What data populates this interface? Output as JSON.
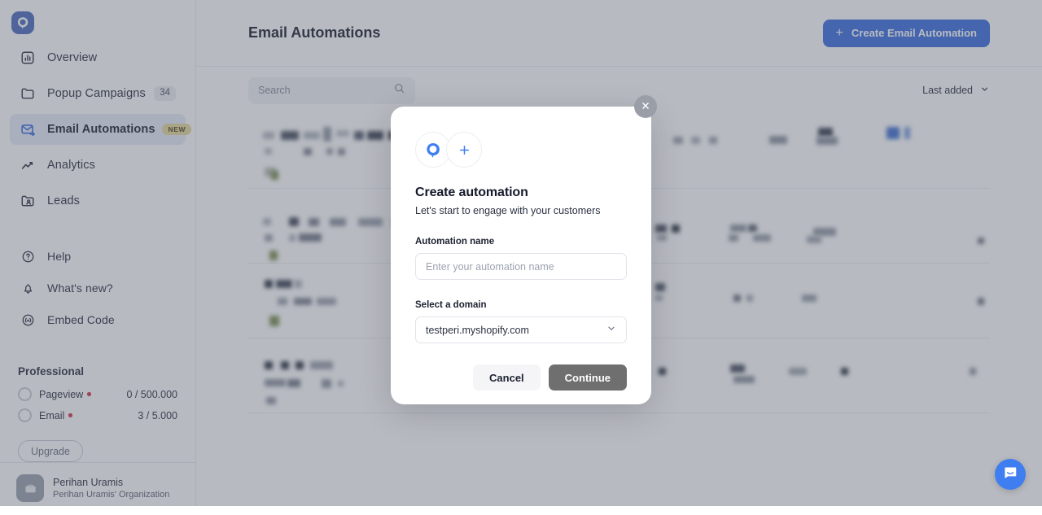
{
  "brand": {
    "logo_icon": "popupsmart-logo-icon",
    "accent_color": "#3b6fe0",
    "overlay_color": "#545a69"
  },
  "sidebar": {
    "primary_items": [
      {
        "label": "Overview",
        "icon": "bar-chart-icon",
        "badge": "",
        "badge_type": "",
        "active": false
      },
      {
        "label": "Popup Campaigns",
        "icon": "folder-icon",
        "badge": "34",
        "badge_type": "count",
        "active": false
      },
      {
        "label": "Email Automations",
        "icon": "envelope-send-icon",
        "badge": "NEW",
        "badge_type": "new",
        "active": true
      },
      {
        "label": "Analytics",
        "icon": "trending-up-icon",
        "badge": "",
        "badge_type": "",
        "active": false
      },
      {
        "label": "Leads",
        "icon": "folder-user-icon",
        "badge": "",
        "badge_type": "",
        "active": false
      }
    ],
    "secondary_items": [
      {
        "label": "Help",
        "icon": "question-circle-icon"
      },
      {
        "label": "What's new?",
        "icon": "bell-icon"
      },
      {
        "label": "Embed Code",
        "icon": "broadcast-icon"
      }
    ],
    "plan": {
      "title": "Professional",
      "quotas": [
        {
          "name": "Pageview",
          "value": "0 / 500.000",
          "status_color": "#d0384a"
        },
        {
          "name": "Email",
          "value": "3 / 5.000",
          "status_color": "#d0384a"
        }
      ],
      "upgrade_label": "Upgrade"
    },
    "account": {
      "avatar_icon": "briefcase-icon",
      "name": "Perihan Uramis",
      "organization": "Perihan Uramis' Organization"
    }
  },
  "header": {
    "title": "Email Automations",
    "create_button": {
      "label": "Create Email Automation",
      "icon": "plus-icon"
    }
  },
  "toolbar": {
    "search": {
      "value": "",
      "placeholder": "Search",
      "icon": "search-icon"
    },
    "sort": {
      "label": "Last added",
      "icon": "chevron-down-icon"
    }
  },
  "modal": {
    "close_icon": "close-icon",
    "icons": [
      "popupsmart-logo-icon",
      "plus-icon"
    ],
    "title": "Create automation",
    "subtitle": "Let's start to engage with your customers",
    "name_field": {
      "label": "Automation name",
      "value": "",
      "placeholder": "Enter your automation name"
    },
    "domain_field": {
      "label": "Select a domain",
      "selected": "testperi.myshopify.com",
      "options": [
        "testperi.myshopify.com"
      ],
      "icon": "chevron-down-icon"
    },
    "cancel_label": "Cancel",
    "continue_label": "Continue"
  },
  "intercom": {
    "icon": "intercom-chat-icon",
    "color": "#3f7ef0"
  }
}
